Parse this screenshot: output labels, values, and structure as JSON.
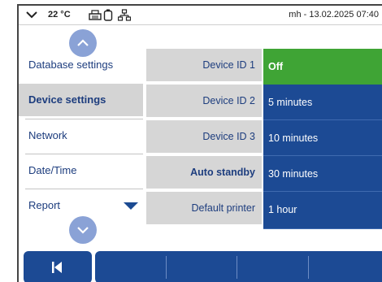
{
  "status_bar": {
    "temperature": "22 °C",
    "user_datetime": "mh - 13.02.2025 07:40",
    "icons": [
      "chevron-down-icon",
      "printer-icon",
      "battery-icon",
      "network-icon"
    ]
  },
  "menu": {
    "items": [
      {
        "label": "Database settings",
        "active": false
      },
      {
        "label": "Device settings",
        "active": true
      },
      {
        "label": "Network",
        "active": false
      },
      {
        "label": "Date/Time",
        "active": false
      },
      {
        "label": "Report",
        "active": false
      }
    ],
    "scroll_up_icon": "chevron-up-icon",
    "scroll_down_icon": "chevron-down-icon"
  },
  "settings": {
    "labels": [
      {
        "text": "Device ID 1",
        "bold": false
      },
      {
        "text": "Device ID 2",
        "bold": false
      },
      {
        "text": "Device ID 3",
        "bold": false
      },
      {
        "text": "Auto standby",
        "bold": true
      },
      {
        "text": "Default printer",
        "bold": false
      }
    ],
    "options": [
      {
        "text": "Off",
        "selected": true
      },
      {
        "text": "5 minutes",
        "selected": false
      },
      {
        "text": "10 minutes",
        "selected": false
      },
      {
        "text": "30 minutes",
        "selected": false
      },
      {
        "text": "1 hour",
        "selected": false
      }
    ]
  },
  "toolbar": {
    "back_icon": "skip-back-icon"
  },
  "colors": {
    "primary_blue": "#1c4a94",
    "selected_green": "#3fa435",
    "text_blue": "#1d3d7e",
    "label_gray": "#d6d6d6",
    "scroll_button": "#8aa2d6"
  }
}
